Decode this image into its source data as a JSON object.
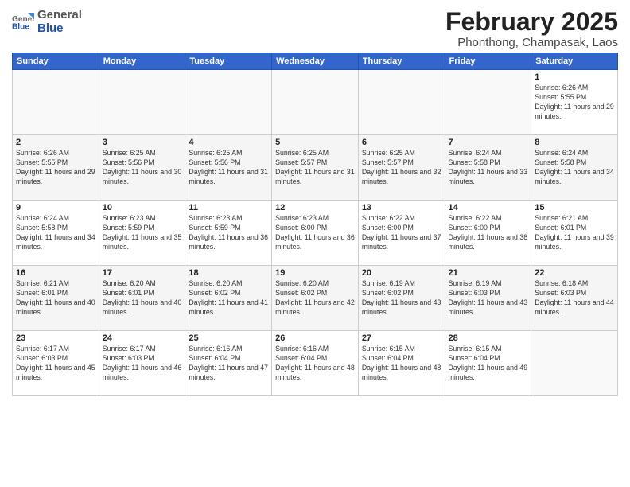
{
  "header": {
    "logo_general": "General",
    "logo_blue": "Blue",
    "month_title": "February 2025",
    "location": "Phonthong, Champasak, Laos"
  },
  "days_of_week": [
    "Sunday",
    "Monday",
    "Tuesday",
    "Wednesday",
    "Thursday",
    "Friday",
    "Saturday"
  ],
  "weeks": [
    [
      {
        "day": "",
        "info": ""
      },
      {
        "day": "",
        "info": ""
      },
      {
        "day": "",
        "info": ""
      },
      {
        "day": "",
        "info": ""
      },
      {
        "day": "",
        "info": ""
      },
      {
        "day": "",
        "info": ""
      },
      {
        "day": "1",
        "info": "Sunrise: 6:26 AM\nSunset: 5:55 PM\nDaylight: 11 hours and 29 minutes."
      }
    ],
    [
      {
        "day": "2",
        "info": "Sunrise: 6:26 AM\nSunset: 5:55 PM\nDaylight: 11 hours and 29 minutes."
      },
      {
        "day": "3",
        "info": "Sunrise: 6:25 AM\nSunset: 5:56 PM\nDaylight: 11 hours and 30 minutes."
      },
      {
        "day": "4",
        "info": "Sunrise: 6:25 AM\nSunset: 5:56 PM\nDaylight: 11 hours and 31 minutes."
      },
      {
        "day": "5",
        "info": "Sunrise: 6:25 AM\nSunset: 5:57 PM\nDaylight: 11 hours and 31 minutes."
      },
      {
        "day": "6",
        "info": "Sunrise: 6:25 AM\nSunset: 5:57 PM\nDaylight: 11 hours and 32 minutes."
      },
      {
        "day": "7",
        "info": "Sunrise: 6:24 AM\nSunset: 5:58 PM\nDaylight: 11 hours and 33 minutes."
      },
      {
        "day": "8",
        "info": "Sunrise: 6:24 AM\nSunset: 5:58 PM\nDaylight: 11 hours and 34 minutes."
      }
    ],
    [
      {
        "day": "9",
        "info": "Sunrise: 6:24 AM\nSunset: 5:58 PM\nDaylight: 11 hours and 34 minutes."
      },
      {
        "day": "10",
        "info": "Sunrise: 6:23 AM\nSunset: 5:59 PM\nDaylight: 11 hours and 35 minutes."
      },
      {
        "day": "11",
        "info": "Sunrise: 6:23 AM\nSunset: 5:59 PM\nDaylight: 11 hours and 36 minutes."
      },
      {
        "day": "12",
        "info": "Sunrise: 6:23 AM\nSunset: 6:00 PM\nDaylight: 11 hours and 36 minutes."
      },
      {
        "day": "13",
        "info": "Sunrise: 6:22 AM\nSunset: 6:00 PM\nDaylight: 11 hours and 37 minutes."
      },
      {
        "day": "14",
        "info": "Sunrise: 6:22 AM\nSunset: 6:00 PM\nDaylight: 11 hours and 38 minutes."
      },
      {
        "day": "15",
        "info": "Sunrise: 6:21 AM\nSunset: 6:01 PM\nDaylight: 11 hours and 39 minutes."
      }
    ],
    [
      {
        "day": "16",
        "info": "Sunrise: 6:21 AM\nSunset: 6:01 PM\nDaylight: 11 hours and 40 minutes."
      },
      {
        "day": "17",
        "info": "Sunrise: 6:20 AM\nSunset: 6:01 PM\nDaylight: 11 hours and 40 minutes."
      },
      {
        "day": "18",
        "info": "Sunrise: 6:20 AM\nSunset: 6:02 PM\nDaylight: 11 hours and 41 minutes."
      },
      {
        "day": "19",
        "info": "Sunrise: 6:20 AM\nSunset: 6:02 PM\nDaylight: 11 hours and 42 minutes."
      },
      {
        "day": "20",
        "info": "Sunrise: 6:19 AM\nSunset: 6:02 PM\nDaylight: 11 hours and 43 minutes."
      },
      {
        "day": "21",
        "info": "Sunrise: 6:19 AM\nSunset: 6:03 PM\nDaylight: 11 hours and 43 minutes."
      },
      {
        "day": "22",
        "info": "Sunrise: 6:18 AM\nSunset: 6:03 PM\nDaylight: 11 hours and 44 minutes."
      }
    ],
    [
      {
        "day": "23",
        "info": "Sunrise: 6:17 AM\nSunset: 6:03 PM\nDaylight: 11 hours and 45 minutes."
      },
      {
        "day": "24",
        "info": "Sunrise: 6:17 AM\nSunset: 6:03 PM\nDaylight: 11 hours and 46 minutes."
      },
      {
        "day": "25",
        "info": "Sunrise: 6:16 AM\nSunset: 6:04 PM\nDaylight: 11 hours and 47 minutes."
      },
      {
        "day": "26",
        "info": "Sunrise: 6:16 AM\nSunset: 6:04 PM\nDaylight: 11 hours and 48 minutes."
      },
      {
        "day": "27",
        "info": "Sunrise: 6:15 AM\nSunset: 6:04 PM\nDaylight: 11 hours and 48 minutes."
      },
      {
        "day": "28",
        "info": "Sunrise: 6:15 AM\nSunset: 6:04 PM\nDaylight: 11 hours and 49 minutes."
      },
      {
        "day": "",
        "info": ""
      }
    ]
  ]
}
